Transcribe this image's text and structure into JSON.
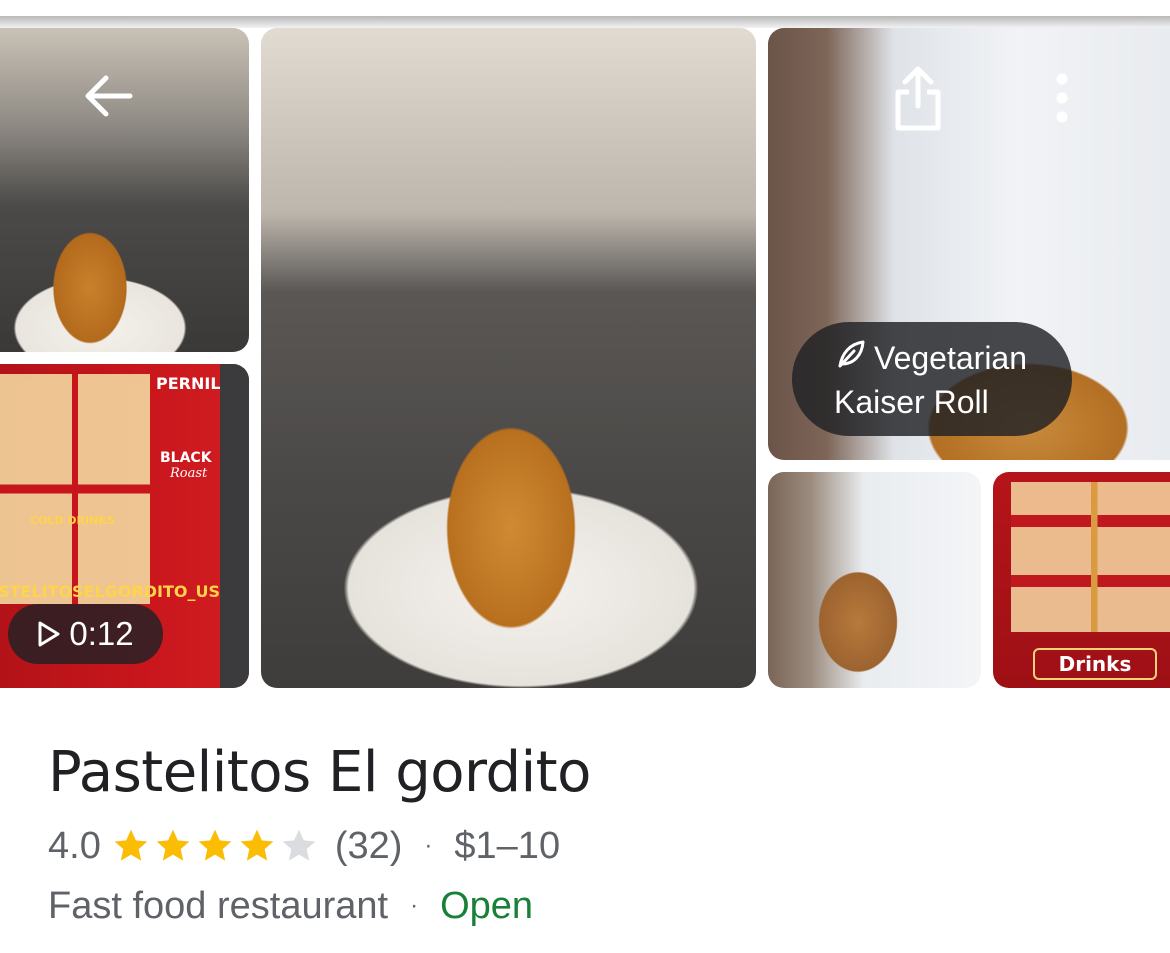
{
  "gallery": {
    "video_duration": "0:12",
    "photo_tag": {
      "line1": "Vegetarian",
      "line2": "Kaiser Roll"
    },
    "menu_photo_texts": {
      "pernil": "PERNIL",
      "black": "BLACK",
      "roast": "Roast",
      "cold_drinks": "COLD DRINKS",
      "handle": "STELITOSELGORDITO_USA"
    },
    "drinks_label": "Drinks"
  },
  "place": {
    "name": "Pastelitos El gordito",
    "rating": "4.0",
    "rating_value": 4.0,
    "rating_max": 5,
    "review_count": "(32)",
    "price_range": "$1–10",
    "category": "Fast food restaurant",
    "status": "Open",
    "separator": "·"
  },
  "icons": {
    "back": "arrow-left-icon",
    "share": "share-icon",
    "more": "more-vert-icon",
    "play": "play-icon",
    "leaf": "leaf-icon",
    "star": "star-icon"
  },
  "colors": {
    "star_filled": "#fbbc04",
    "star_empty": "#dadce0",
    "open_green": "#188038",
    "text_primary": "#202124",
    "text_secondary": "#5f6368"
  }
}
